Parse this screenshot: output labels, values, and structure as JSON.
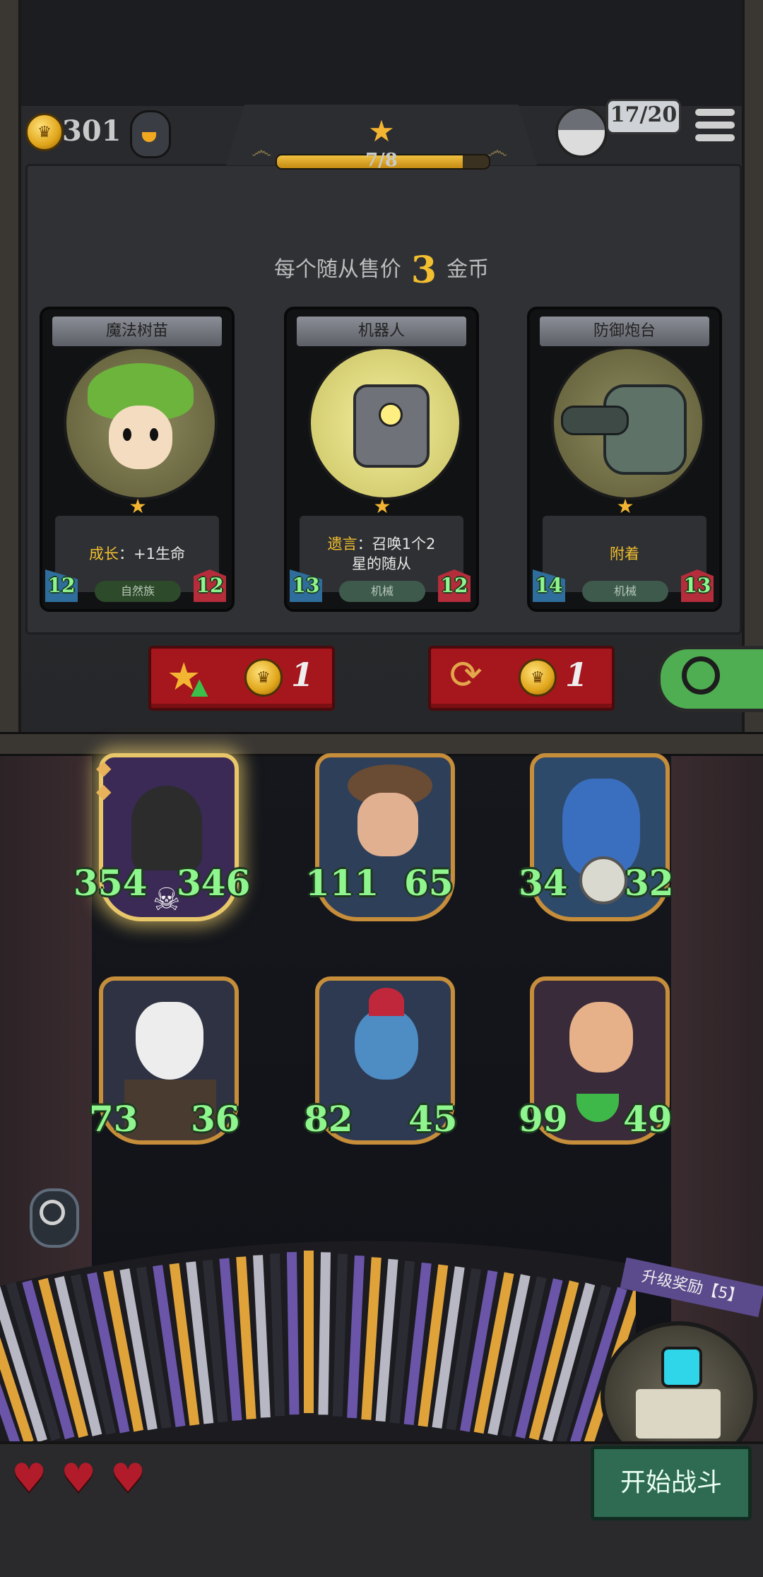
{
  "hud": {
    "gold": "301",
    "level_progress": "7/8",
    "level_fraction": 0.875,
    "population": "17/20"
  },
  "shop": {
    "price_prefix": "每个随从售价",
    "price_value": "3",
    "price_suffix": "金币",
    "cards": [
      {
        "name": "魔法树苗",
        "desc_kw": "成长",
        "desc_rest": "：+1生命",
        "tribe": "自然族",
        "attack": "12",
        "health": "12"
      },
      {
        "name": "机器人",
        "desc_kw": "遗言",
        "desc_rest": "：召唤1个2星的随从",
        "tribe": "机械",
        "attack": "13",
        "health": "12"
      },
      {
        "name": "防御炮台",
        "desc_kw": "附着",
        "desc_rest": "",
        "tribe": "机械",
        "attack": "14",
        "health": "13"
      }
    ],
    "upgrade_cost": "1",
    "refresh_cost": "1"
  },
  "board": {
    "minions": [
      {
        "attack": "354",
        "health": "346"
      },
      {
        "attack": "111",
        "health": "65"
      },
      {
        "attack": "34",
        "health": "32"
      },
      {
        "attack": "73",
        "health": "36"
      },
      {
        "attack": "82",
        "health": "45"
      },
      {
        "attack": "99",
        "health": "49"
      }
    ]
  },
  "reward": {
    "label": "升级奖励【5】"
  },
  "start_button": "开始战斗",
  "colors": {
    "gold": "#f1bf2f",
    "stat_green": "#8ff58f",
    "button_red": "#a5161d",
    "start_green": "#2e6b52"
  }
}
